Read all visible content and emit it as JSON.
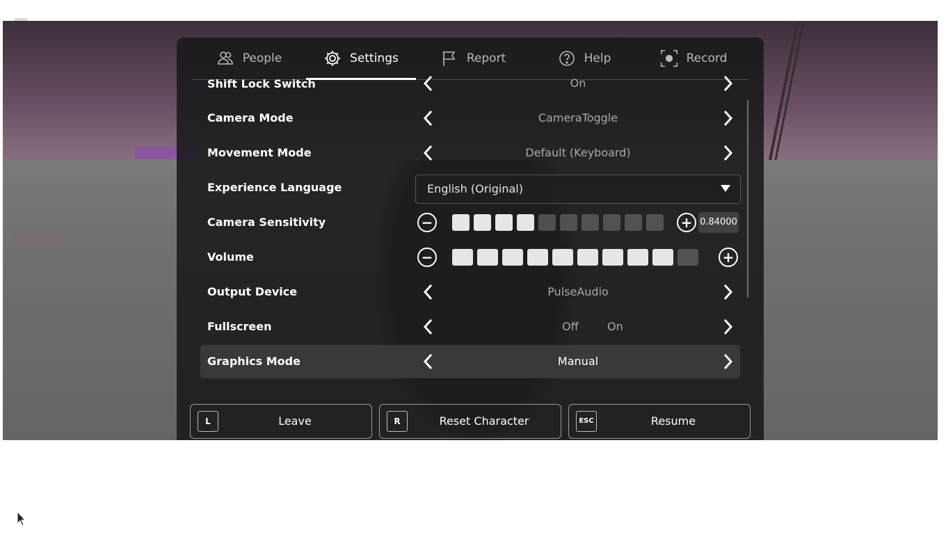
{
  "tabs": [
    {
      "label": "People",
      "icon": "people-icon",
      "active": false
    },
    {
      "label": "Settings",
      "icon": "gear-icon",
      "active": true
    },
    {
      "label": "Report",
      "icon": "flag-icon",
      "active": false
    },
    {
      "label": "Help",
      "icon": "help-icon",
      "active": false
    },
    {
      "label": "Record",
      "icon": "record-icon",
      "active": false
    }
  ],
  "settings": {
    "shift_lock": {
      "label": "Shift Lock Switch",
      "value": "On"
    },
    "camera_mode": {
      "label": "Camera Mode",
      "value": "CameraToggle"
    },
    "movement_mode": {
      "label": "Movement Mode",
      "value": "Default (Keyboard)"
    },
    "experience_language": {
      "label": "Experience Language",
      "value": "English (Original)"
    },
    "camera_sensitivity": {
      "label": "Camera Sensitivity",
      "value": "0.84000",
      "filled_segments": 4,
      "total_segments": 10
    },
    "volume": {
      "label": "Volume",
      "filled_segments": 9,
      "total_segments": 10
    },
    "output_device": {
      "label": "Output Device",
      "value": "PulseAudio"
    },
    "fullscreen": {
      "label": "Fullscreen",
      "off_label": "Off",
      "on_label": "On"
    },
    "graphics_mode": {
      "label": "Graphics Mode",
      "value": "Manual"
    }
  },
  "buttons": {
    "leave": {
      "key": "L",
      "label": "Leave"
    },
    "reset": {
      "key": "R",
      "label": "Reset Character"
    },
    "resume": {
      "key": "ESC",
      "label": "Resume"
    }
  },
  "colors": {
    "panel": "#16171a",
    "text": "#ffffff",
    "muted": "#a8a9ac"
  }
}
